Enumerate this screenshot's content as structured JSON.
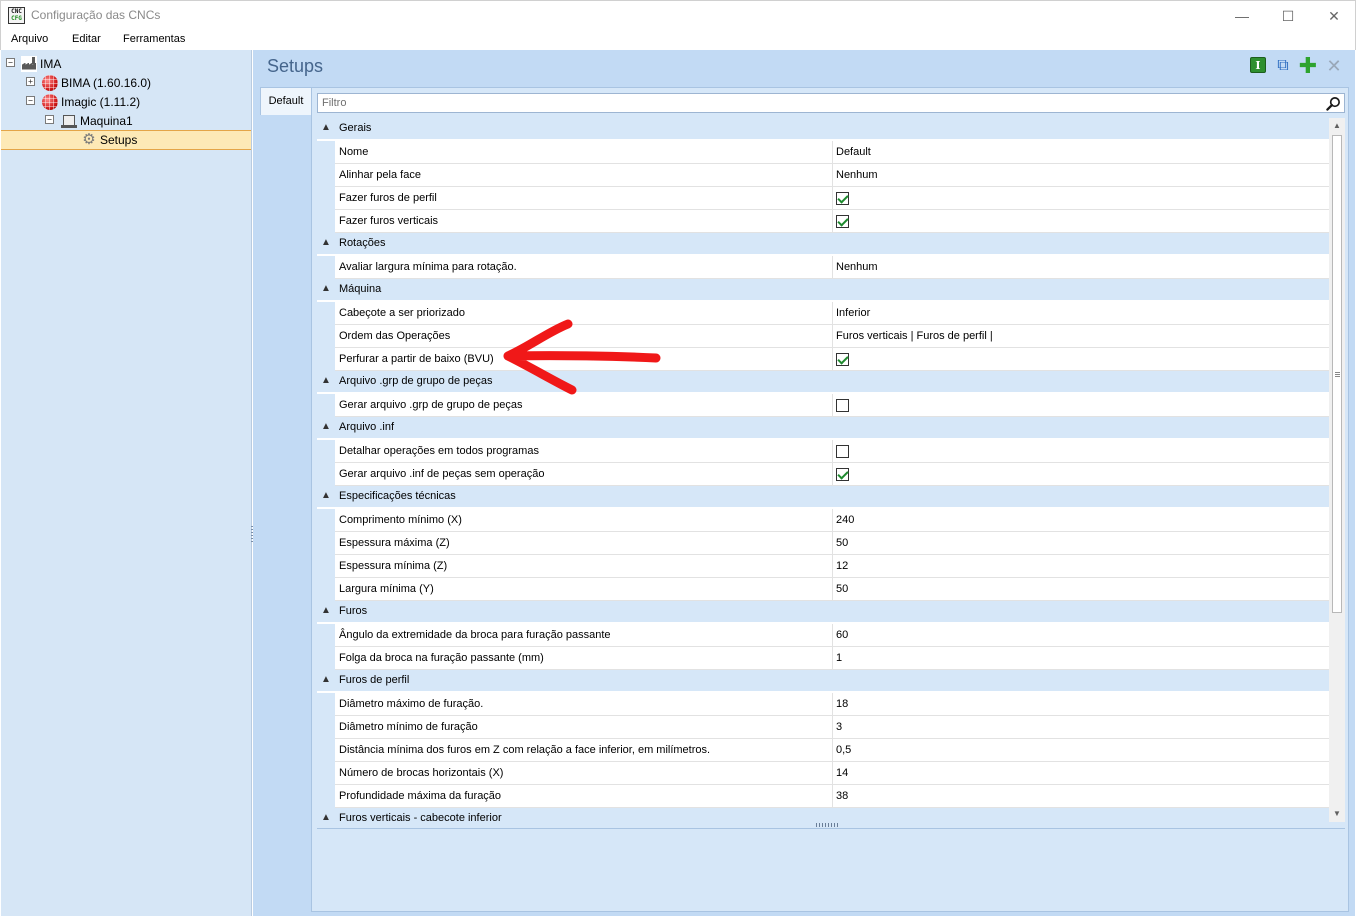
{
  "window": {
    "title": "Configuração das CNCs",
    "icon_text_top": "CNC",
    "icon_text_bottom": "CFG",
    "minimize_glyph": "—",
    "maximize_glyph": "☐",
    "close_glyph": "✕"
  },
  "menu": [
    "Arquivo",
    "Editar",
    "Ferramentas"
  ],
  "tree": {
    "root": {
      "label": "IMA",
      "icon": "factory-icon",
      "expander": "−"
    },
    "bima": {
      "label": "BIMA (1.60.16.0)",
      "icon": "red-ball-icon",
      "expander": "+"
    },
    "imagic": {
      "label": "Imagic (1.11.2)",
      "icon": "red-ball-icon",
      "expander": "−"
    },
    "maquina": {
      "label": "Maquina1",
      "icon": "machine-icon",
      "expander": "−"
    },
    "setups": {
      "label": "Setups",
      "icon": "gear-icon",
      "selected": true
    }
  },
  "panel": {
    "title": "Setups",
    "toolbar": {
      "info_glyph": "I",
      "copy_glyph": "⧉",
      "add_glyph": "✚",
      "delete_glyph": "✕"
    },
    "tab_label": "Default",
    "filter_placeholder": "Filtro"
  },
  "grid": {
    "categories": [
      {
        "label": "Gerais",
        "props": [
          {
            "name": "Nome",
            "value": "Default"
          },
          {
            "name": "Alinhar pela face",
            "value": "Nenhum"
          },
          {
            "name": "Fazer furos de perfil",
            "checked": true
          },
          {
            "name": "Fazer furos verticais",
            "checked": true
          }
        ]
      },
      {
        "label": "Rotações",
        "props": [
          {
            "name": "Avaliar largura mínima para rotação.",
            "value": "Nenhum"
          }
        ]
      },
      {
        "label": "Máquina",
        "props": [
          {
            "name": "Cabeçote a ser priorizado",
            "value": "Inferior"
          },
          {
            "name": "Ordem das Operações",
            "value": "Furos verticais | Furos de perfil |"
          },
          {
            "name": "Perfurar a partir de baixo (BVU)",
            "checked": true
          }
        ]
      },
      {
        "label": "Arquivo .grp de grupo de peças",
        "props": [
          {
            "name": "Gerar arquivo .grp de grupo de peças",
            "checked": false
          }
        ]
      },
      {
        "label": "Arquivo .inf",
        "props": [
          {
            "name": "Detalhar operações em todos programas",
            "checked": false
          },
          {
            "name": "Gerar arquivo .inf de peças sem operação",
            "checked": true
          }
        ]
      },
      {
        "label": "Especificações técnicas",
        "props": [
          {
            "name": "Comprimento mínimo (X)",
            "value": "240"
          },
          {
            "name": "Espessura máxima (Z)",
            "value": "50"
          },
          {
            "name": "Espessura mínima (Z)",
            "value": "12"
          },
          {
            "name": "Largura mínima (Y)",
            "value": "50"
          }
        ]
      },
      {
        "label": "Furos",
        "props": [
          {
            "name": "Ângulo da extremidade da broca para furação passante",
            "value": "60"
          },
          {
            "name": "Folga da broca na furação passante (mm)",
            "value": "1"
          }
        ]
      },
      {
        "label": "Furos de perfil",
        "props": [
          {
            "name": "Diâmetro máximo de furação.",
            "value": "18"
          },
          {
            "name": "Diâmetro mínimo de furação",
            "value": "3"
          },
          {
            "name": "Distância mínima dos furos em Z com relação a face inferior, em milímetros.",
            "value": "0,5"
          },
          {
            "name": "Número de brocas horizontais (X)",
            "value": "14"
          },
          {
            "name": "Profundidade máxima da furação",
            "value": "38"
          }
        ]
      },
      {
        "label": "Furos verticais - cabecote inferior",
        "props": []
      }
    ],
    "chevron_glyph": "▲",
    "scroll_up_glyph": "▲",
    "scroll_down_glyph": "▼"
  },
  "colors": {
    "annotation_arrow": "#f01818",
    "selection_bg": "#fde9b6",
    "panel_bg": "#c2daf4",
    "title_accent": "#45658c"
  }
}
